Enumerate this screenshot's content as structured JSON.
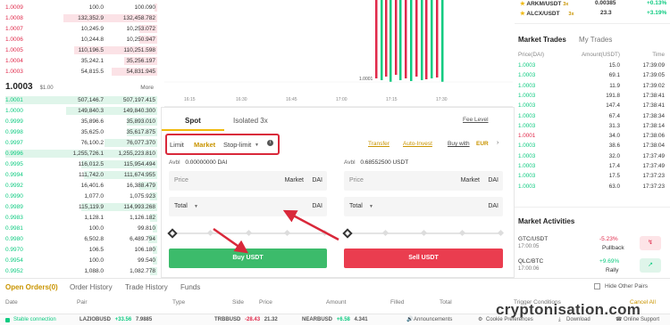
{
  "orderbook": {
    "asks": [
      {
        "price": "1.0009",
        "amount": "100.0",
        "total": "100.090",
        "fill": 0.02
      },
      {
        "price": "1.0008",
        "amount": "132,352.9",
        "total": "132,458.782",
        "fill": 0.62
      },
      {
        "price": "1.0007",
        "amount": "10,245.9",
        "total": "10,253.072",
        "fill": 0.12
      },
      {
        "price": "1.0006",
        "amount": "10,244.8",
        "total": "10,250.947",
        "fill": 0.12
      },
      {
        "price": "1.0005",
        "amount": "110,196.5",
        "total": "110,251.598",
        "fill": 0.55
      },
      {
        "price": "1.0004",
        "amount": "35,242.1",
        "total": "35,256.197",
        "fill": 0.22
      },
      {
        "price": "1.0003",
        "amount": "54,815.5",
        "total": "54,831.945",
        "fill": 0.3
      }
    ],
    "mid": {
      "price": "1.0003",
      "usd": "$1.00",
      "more": "More"
    },
    "bids": [
      {
        "price": "1.0001",
        "amount": "507,146.7",
        "total": "507,197.415",
        "fill": 1.0
      },
      {
        "price": "1.0000",
        "amount": "149,840.3",
        "total": "149,840.300",
        "fill": 0.6
      },
      {
        "price": "0.9999",
        "amount": "35,896.6",
        "total": "35,893.010",
        "fill": 0.2
      },
      {
        "price": "0.9998",
        "amount": "35,625.0",
        "total": "35,617.875",
        "fill": 0.2
      },
      {
        "price": "0.9997",
        "amount": "76,100.2",
        "total": "76,077.370",
        "fill": 0.35
      },
      {
        "price": "0.9996",
        "amount": "1,255,726.1",
        "total": "1,255,223.810",
        "fill": 1.0
      },
      {
        "price": "0.9995",
        "amount": "116,012.5",
        "total": "115,954.494",
        "fill": 0.5
      },
      {
        "price": "0.9994",
        "amount": "111,742.0",
        "total": "111,674.955",
        "fill": 0.48
      },
      {
        "price": "0.9992",
        "amount": "16,401.6",
        "total": "16,388.479",
        "fill": 0.12
      },
      {
        "price": "0.9990",
        "amount": "1,077.0",
        "total": "1,075.923",
        "fill": 0.05
      },
      {
        "price": "0.9989",
        "amount": "115,119.9",
        "total": "114,993.268",
        "fill": 0.5
      },
      {
        "price": "0.9983",
        "amount": "1,128.1",
        "total": "1,126.182",
        "fill": 0.05
      },
      {
        "price": "0.9981",
        "amount": "100.0",
        "total": "99.810",
        "fill": 0.03
      },
      {
        "price": "0.9980",
        "amount": "6,502.8",
        "total": "6,489.794",
        "fill": 0.06
      },
      {
        "price": "0.9970",
        "amount": "106.5",
        "total": "106.180",
        "fill": 0.03
      },
      {
        "price": "0.9954",
        "amount": "100.0",
        "total": "99.540",
        "fill": 0.03
      },
      {
        "price": "0.9952",
        "amount": "1,088.0",
        "total": "1,082.778",
        "fill": 0.05
      }
    ]
  },
  "chart": {
    "price_label": "1.0001",
    "times": [
      "16:15",
      "16:30",
      "16:45",
      "17:00",
      "17:15",
      "17:30"
    ]
  },
  "trade_panel": {
    "tabs": [
      "Spot",
      "Isolated 3x"
    ],
    "fee_level": "Fee Level",
    "order_types": [
      "Limit",
      "Market",
      "Stop-limit"
    ],
    "transfer": "Transfer",
    "auto_invest": "Auto-Invest",
    "buy_with": "Buy with",
    "currency": "EUR",
    "buy": {
      "avbl_label": "Avbl",
      "avbl_value": "0.00000000 DAI",
      "price_label": "Price",
      "price_value": "Market",
      "price_unit": "DAI",
      "total_label": "Total",
      "total_unit": "DAI",
      "button": "Buy USDT"
    },
    "sell": {
      "avbl_label": "Avbl",
      "avbl_value": "0.68552500 USDT",
      "price_label": "Price",
      "price_value": "Market",
      "price_unit": "DAI",
      "total_label": "Total",
      "total_unit": "DAI",
      "button": "Sell USDT"
    }
  },
  "tickers": [
    {
      "pair": "ARKM/USDT",
      "lev": "3x",
      "price": "0.00385",
      "change": "+0.13%"
    },
    {
      "pair": "ALCX/USDT",
      "lev": "3x",
      "price": "23.3",
      "change": "+3.19%"
    }
  ],
  "market_trades": {
    "tabs": [
      "Market Trades",
      "My Trades"
    ],
    "headers": [
      "Price(DAI)",
      "Amount(USDT)",
      "Time"
    ],
    "rows": [
      {
        "price": "1.0003",
        "amount": "15.0",
        "time": "17:39:09",
        "side": "buy"
      },
      {
        "price": "1.0003",
        "amount": "69.1",
        "time": "17:39:05",
        "side": "buy"
      },
      {
        "price": "1.0003",
        "amount": "11.9",
        "time": "17:39:02",
        "side": "buy"
      },
      {
        "price": "1.0003",
        "amount": "191.8",
        "time": "17:38:41",
        "side": "buy"
      },
      {
        "price": "1.0003",
        "amount": "147.4",
        "time": "17:38:41",
        "side": "buy"
      },
      {
        "price": "1.0003",
        "amount": "67.4",
        "time": "17:38:34",
        "side": "buy"
      },
      {
        "price": "1.0003",
        "amount": "31.3",
        "time": "17:38:14",
        "side": "buy"
      },
      {
        "price": "1.0001",
        "amount": "34.0",
        "time": "17:38:06",
        "side": "sell"
      },
      {
        "price": "1.0003",
        "amount": "38.6",
        "time": "17:38:04",
        "side": "buy"
      },
      {
        "price": "1.0003",
        "amount": "32.0",
        "time": "17:37:49",
        "side": "buy"
      },
      {
        "price": "1.0003",
        "amount": "17.4",
        "time": "17:37:49",
        "side": "buy"
      },
      {
        "price": "1.0003",
        "amount": "17.5",
        "time": "17:37:23",
        "side": "buy"
      },
      {
        "price": "1.0003",
        "amount": "63.0",
        "time": "17:37:23",
        "side": "buy"
      }
    ]
  },
  "market_activities": {
    "title": "Market Activities",
    "items": [
      {
        "pair": "GTC/USDT",
        "time": "17:00:05",
        "change": "-5.23%",
        "label": "Pullback",
        "dir": "down"
      },
      {
        "pair": "QLC/BTC",
        "time": "17:00:06",
        "change": "+9.69%",
        "label": "Rally",
        "dir": "up"
      }
    ]
  },
  "bottom_tabs": [
    "Open Orders(0)",
    "Order History",
    "Trade History",
    "Funds"
  ],
  "hide_other_pairs": "Hide Other Pairs",
  "cancel_all": "Cancel All",
  "columns": [
    "Date",
    "Pair",
    "Type",
    "Side",
    "Price",
    "Amount",
    "Filled",
    "Total",
    "Trigger Conditions"
  ],
  "status_bar": {
    "connection": "Stable connection",
    "ticks": [
      {
        "pair": "LAZIOBUSD",
        "change": "+33.56",
        "price": "7.9885",
        "dir": "up"
      },
      {
        "pair": "TRBBUSD",
        "change": "-28.43",
        "price": "21.32",
        "dir": "down"
      },
      {
        "pair": "NEARBUSD",
        "change": "+6.58",
        "price": "4.341",
        "dir": "up"
      }
    ],
    "links": [
      "Announcements",
      "Cookie Preferences",
      "Download",
      "Online Support"
    ]
  },
  "watermark": "cryptonisation.com",
  "colors": {
    "buy": "#3cbb6b",
    "sell": "#ea3d4f",
    "accent": "#f0b90b",
    "annot": "#d9283a"
  }
}
